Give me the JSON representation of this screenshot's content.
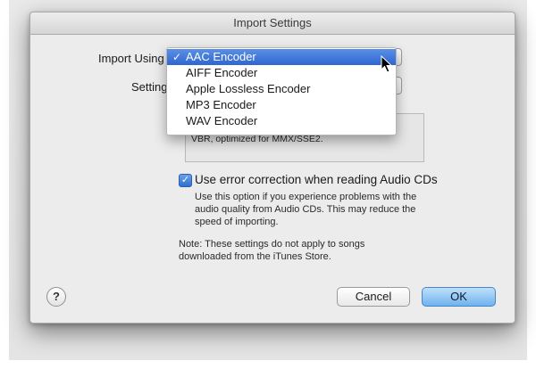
{
  "dialog": {
    "title": "Import Settings"
  },
  "import_using": {
    "label": "Import Using",
    "options": [
      "AAC Encoder",
      "AIFF Encoder",
      "Apple Lossless Encoder",
      "MP3 Encoder",
      "WAV Encoder"
    ],
    "selected": "AAC Encoder",
    "check_glyph": "✓"
  },
  "setting": {
    "label": "Setting"
  },
  "details": {
    "text": "VBR, optimized for MMX/SSE2."
  },
  "error_correction": {
    "checked": true,
    "label": "Use error correction when reading Audio CDs",
    "description_lines": [
      "Use this option if you experience problems with the",
      "audio quality from Audio CDs.  This may reduce the",
      "speed of importing."
    ]
  },
  "note_lines": [
    "Note: These settings do not apply to songs",
    "downloaded from the iTunes Store."
  ],
  "buttons": {
    "help": "?",
    "cancel": "Cancel",
    "ok": "OK"
  },
  "colors": {
    "accent": "#2f66d0",
    "default_button": "#6fb2ee"
  },
  "icons": {
    "help": "question-mark-icon",
    "check": "checkmark-icon",
    "cursor": "mouse-pointer-icon"
  }
}
